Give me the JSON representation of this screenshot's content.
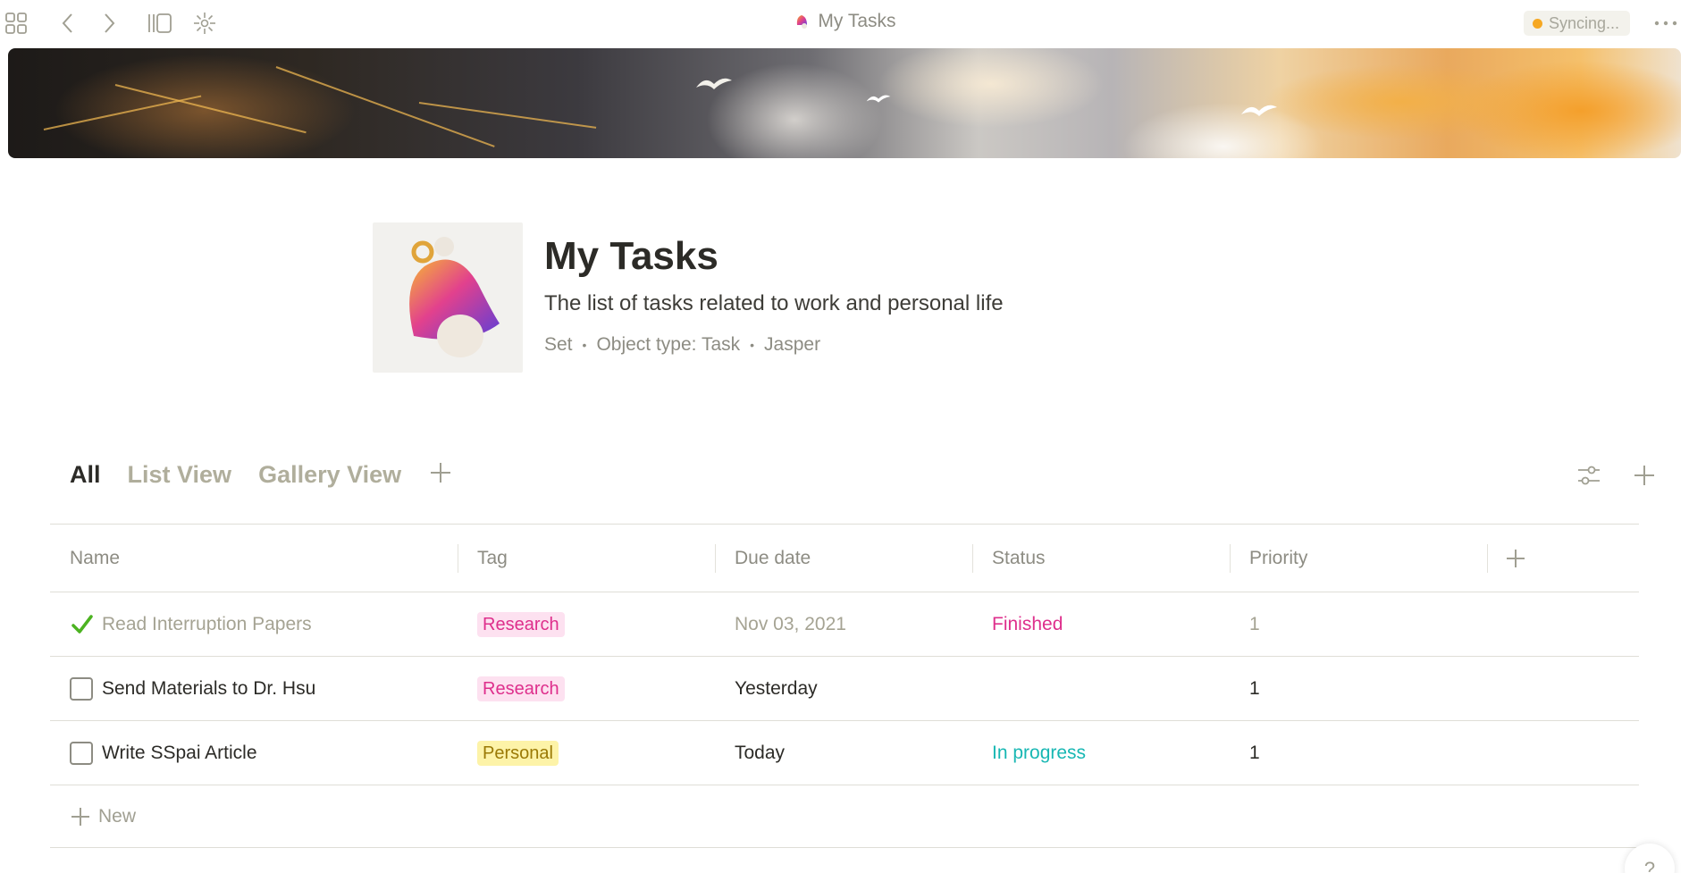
{
  "window": {
    "title": "My Tasks",
    "sync_status": "Syncing..."
  },
  "header": {
    "title": "My Tasks",
    "description": "The list of tasks related to work and personal life",
    "meta": [
      "Set",
      "Object type: Task",
      "Jasper"
    ]
  },
  "views": {
    "tabs": [
      "All",
      "List View",
      "Gallery View"
    ],
    "active": "All"
  },
  "table": {
    "columns": [
      "Name",
      "Tag",
      "Due date",
      "Status",
      "Priority"
    ],
    "rows": [
      {
        "name": "Read Interruption Papers",
        "done": true,
        "tag": "Research",
        "due": "Nov 03, 2021",
        "status": "Finished",
        "priority": "1"
      },
      {
        "name": "Send Materials to Dr. Hsu",
        "done": false,
        "tag": "Research",
        "due": "Yesterday",
        "status": "",
        "priority": "1"
      },
      {
        "name": "Write SSpai Article",
        "done": false,
        "tag": "Personal",
        "due": "Today",
        "status": "In progress",
        "priority": "1"
      }
    ],
    "new_label": "New"
  },
  "help_label": "?",
  "colors": {
    "research_text": "#de2f8c",
    "research_bg": "#fde1f0",
    "personal_text": "#9b7a06",
    "personal_bg": "#fdf3a8",
    "finished": "#de2f8c",
    "in_progress": "#17b7b3",
    "sync_dot": "#f6a823",
    "check_done": "#4cb321"
  },
  "icons": {
    "window_title": "bell-icon",
    "page_icon": "bell-icon"
  }
}
